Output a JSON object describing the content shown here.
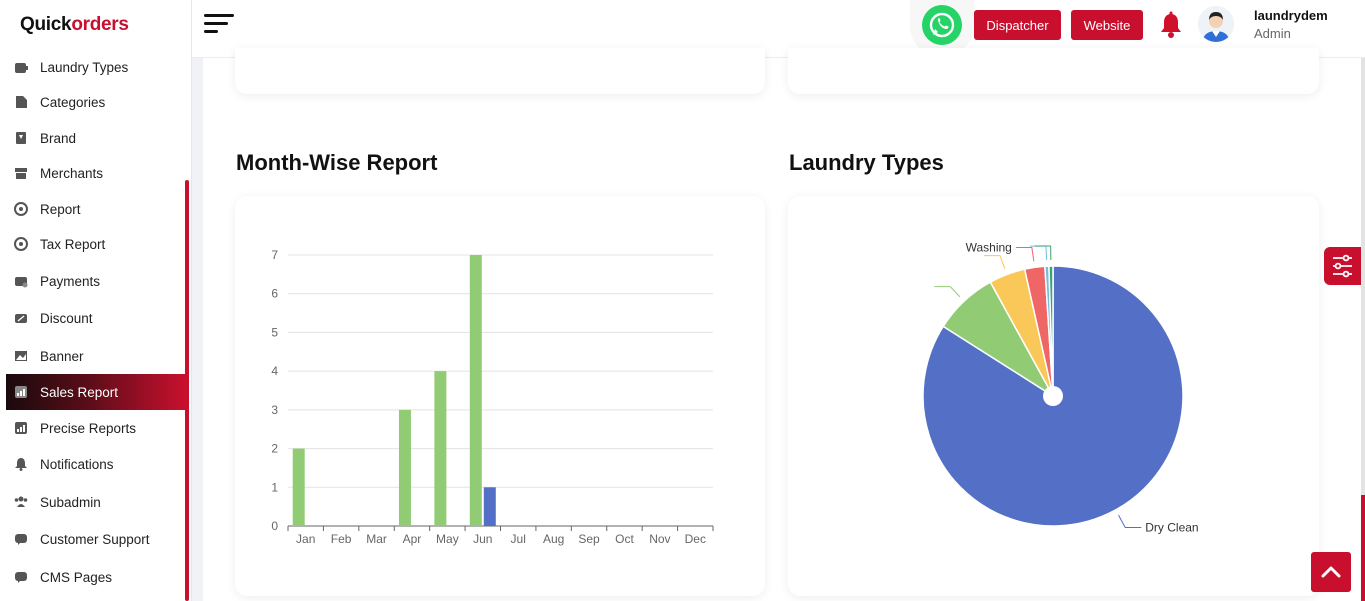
{
  "brand": {
    "part1": "Quick",
    "part2": "orders"
  },
  "sidebar": {
    "items": [
      {
        "label": "Laundry Types",
        "icon": "laundry-icon"
      },
      {
        "label": "Categories",
        "icon": "categories-icon"
      },
      {
        "label": "Brand",
        "icon": "brand-icon"
      },
      {
        "label": "Merchants",
        "icon": "store-icon"
      },
      {
        "label": "Report",
        "icon": "report-icon"
      },
      {
        "label": "Tax Report",
        "icon": "tax-report-icon"
      },
      {
        "label": "Payments",
        "icon": "payments-icon"
      },
      {
        "label": "Discount",
        "icon": "discount-icon"
      },
      {
        "label": "Banner",
        "icon": "banner-icon"
      },
      {
        "label": "Sales Report",
        "icon": "sales-report-icon",
        "active": true
      },
      {
        "label": "Precise Reports",
        "icon": "precise-reports-icon"
      },
      {
        "label": "Notifications",
        "icon": "bell-icon"
      },
      {
        "label": "Subadmin",
        "icon": "users-icon"
      },
      {
        "label": "Customer Support",
        "icon": "support-icon"
      },
      {
        "label": "CMS Pages",
        "icon": "cms-icon"
      }
    ]
  },
  "topbar": {
    "dispatcher_label": "Dispatcher",
    "website_label": "Website",
    "user_name": "laundrydem",
    "user_role": "Admin"
  },
  "sections": {
    "month_title": "Month-Wise Report",
    "laundry_title": "Laundry Types"
  },
  "colors": {
    "accent": "#c8102e",
    "green": "#91cc75",
    "blue": "#5470c6",
    "yellow": "#fac858",
    "red": "#ee6666"
  },
  "chart_data": [
    {
      "type": "bar",
      "categories": [
        "Jan",
        "Feb",
        "Mar",
        "Apr",
        "May",
        "Jun",
        "Jul",
        "Aug",
        "Sep",
        "Oct",
        "Nov",
        "Dec"
      ],
      "series": [
        {
          "values": [
            2,
            0,
            0,
            3,
            4,
            7,
            0,
            0,
            0,
            0,
            0,
            0
          ],
          "color": "#91cc75"
        },
        {
          "values": [
            0,
            0,
            0,
            0,
            0,
            1,
            0,
            0,
            0,
            0,
            0,
            0
          ],
          "color": "#5470c6"
        }
      ],
      "ylim": [
        0,
        7
      ],
      "yticks": [
        0,
        1,
        2,
        3,
        4,
        5,
        6,
        7
      ],
      "grid": true
    },
    {
      "type": "pie",
      "slices": [
        {
          "label": "Dry Clean",
          "value": 84,
          "color": "#5470c6"
        },
        {
          "label": "",
          "value": 8,
          "color": "#91cc75"
        },
        {
          "label": "",
          "value": 4.5,
          "color": "#fac858"
        },
        {
          "label": "Washing",
          "value": 2.5,
          "color": "#ee6666"
        },
        {
          "label": "",
          "value": 0.5,
          "color": "#73c0de"
        },
        {
          "label": "",
          "value": 0.5,
          "color": "#3ba272"
        }
      ]
    }
  ]
}
